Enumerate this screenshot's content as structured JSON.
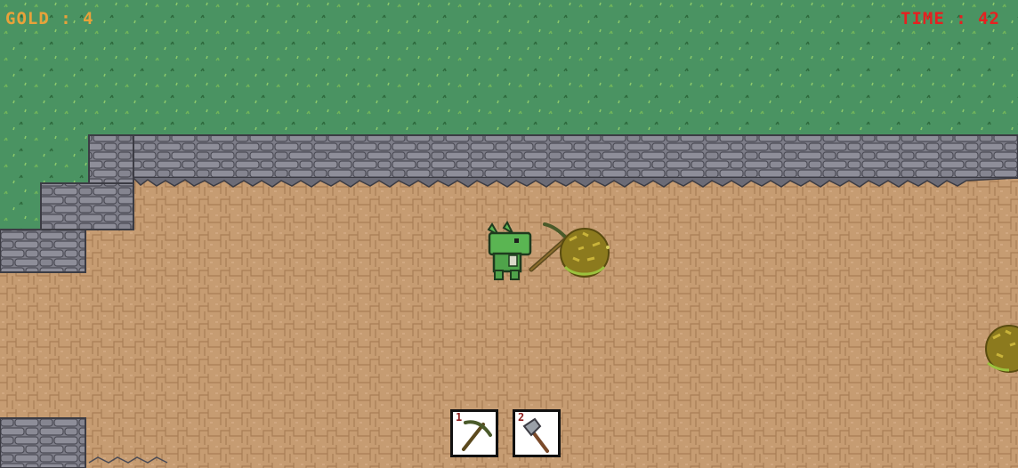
{
  "hud": {
    "gold_label": "GOLD : 4",
    "time_label": "TIME : 42",
    "gold_color": "#e8a23a",
    "time_color": "#e62020"
  },
  "hotbar": {
    "slots": [
      {
        "key": "1",
        "tool": "pickaxe-icon"
      },
      {
        "key": "2",
        "tool": "axe-icon"
      }
    ]
  },
  "colors": {
    "grass": "#4a9362",
    "dirt": "#c69c72",
    "stone": "#7d7d88",
    "player": "#5ab552",
    "gold_ore": "#8c7a1e"
  }
}
